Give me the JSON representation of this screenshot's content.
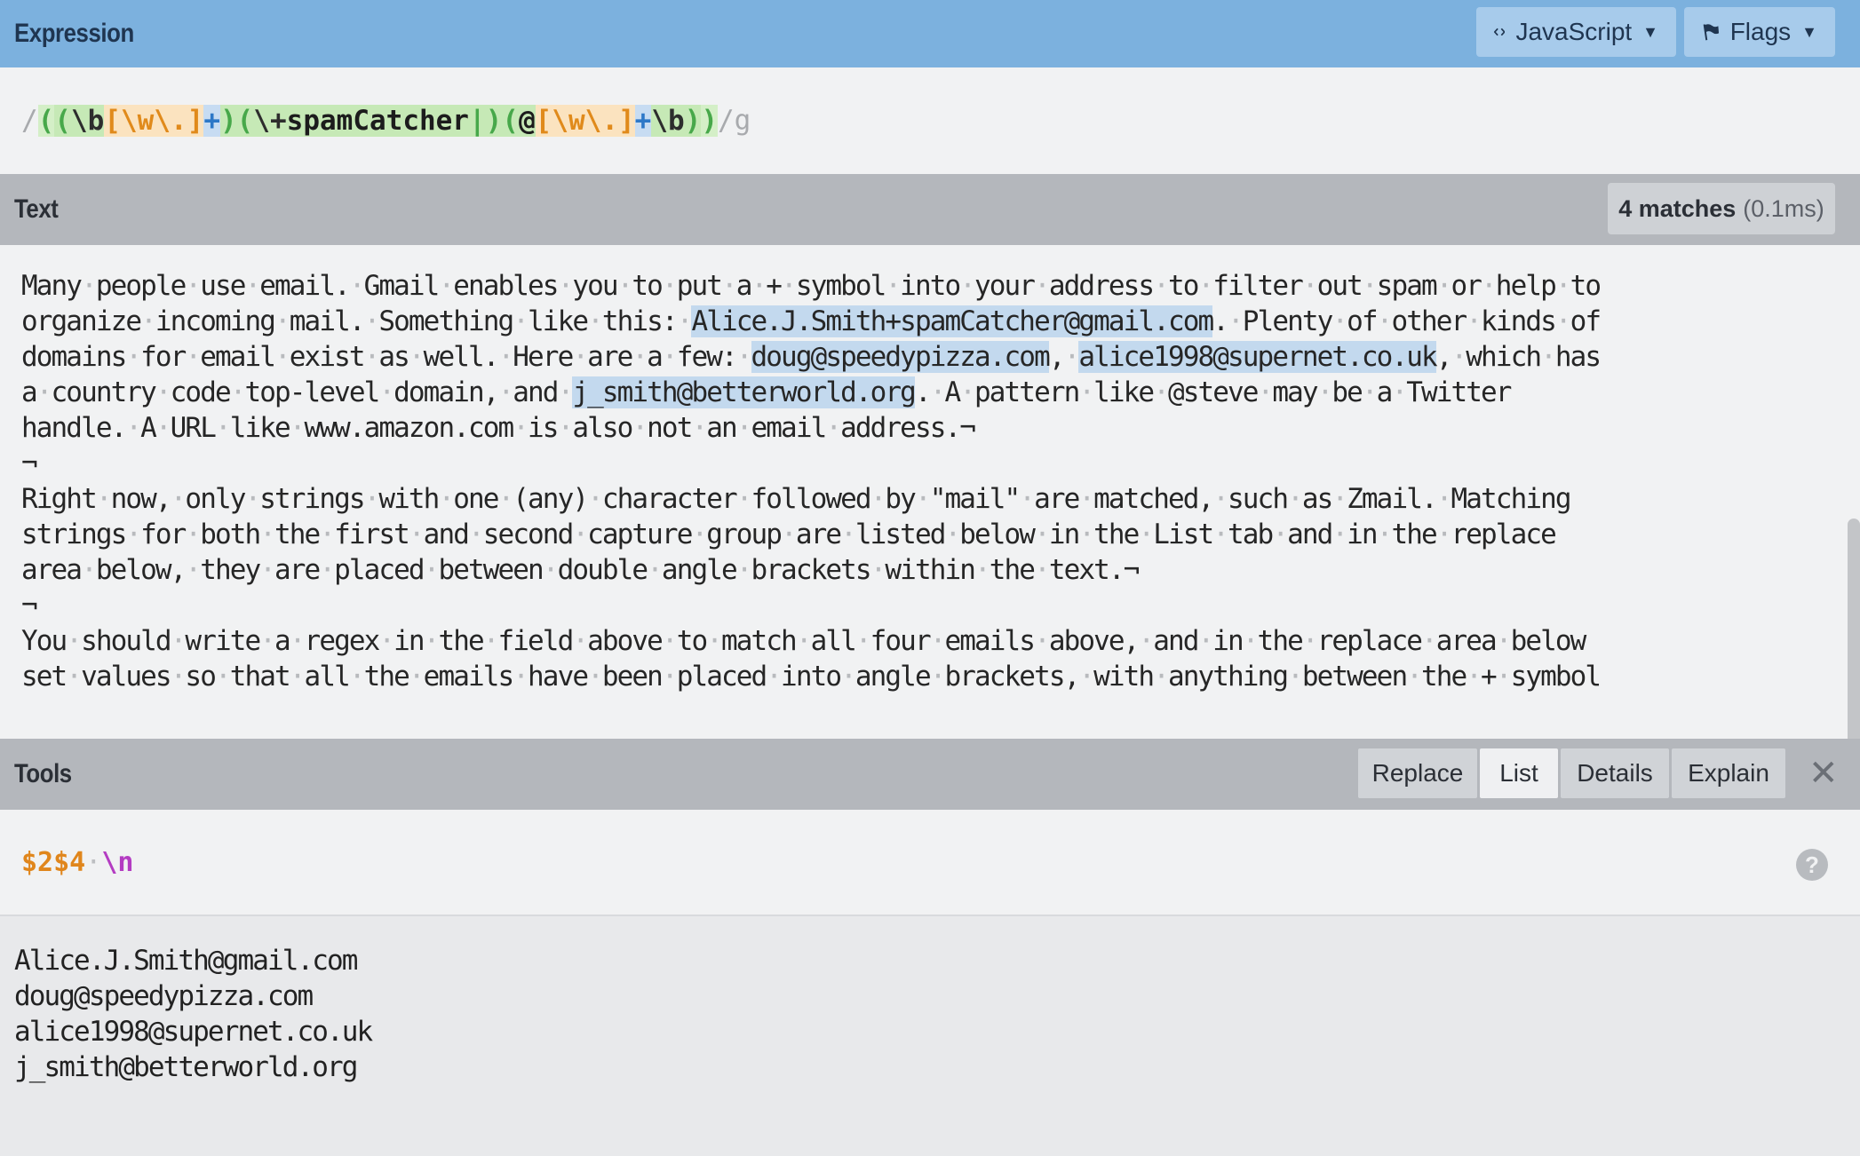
{
  "expression": {
    "title": "Expression",
    "language_label": "JavaScript",
    "flags_label": "Flags",
    "open_delim": "/",
    "tokens": {
      "g1_open": "(",
      "g2_open": "(",
      "b1": "\\b",
      "set1": "[\\w\\.]",
      "q1": "+",
      "g2_close": ")",
      "g3_open": "(",
      "esc_plus": "\\+",
      "literal": "spamCatcher",
      "alt": "|",
      "g3_close": ")",
      "g4_open": "(",
      "at": "@",
      "set2": "[\\w\\.]",
      "q2": "+",
      "b2": "\\b",
      "g4_close": ")",
      "g1_close": ")"
    },
    "close_delim": "/",
    "flags": "g"
  },
  "text_panel": {
    "title": "Text",
    "match_count": "4 matches",
    "match_time": "(0.1ms)",
    "lines": [
      "Many people use email. Gmail enables you to put a + symbol into your address to filter out spam or help to",
      "organize incoming mail. Something like this: |Alice.J.Smith+spamCatcher@gmail.com|. Plenty of other kinds of",
      "domains for email exist as well. Here are a few: |doug@speedypizza.com|, |alice1998@supernet.co.uk|, which has",
      "a country code top-level domain, and |j_smith@betterworld.org|. A pattern like @steve may be a Twitter",
      "handle. A URL like www.amazon.com is also not an email address.¬",
      "¬",
      "Right now, only strings with one (any) character followed by \"mail\" are matched, such as Zmail. Matching",
      "strings for both the first and second capture group are listed below in the List tab and in the replace",
      "area below, they are placed between double angle brackets within the text.¬",
      "¬",
      "You should write a regex in the field above to match all four emails above, and in the replace area below",
      "set values so that all the emails have been placed into angle brackets, with anything between the + symbol"
    ]
  },
  "tools": {
    "title": "Tools",
    "tabs": [
      "Replace",
      "List",
      "Details",
      "Explain"
    ],
    "active_tab": "List",
    "close_glyph": "✕",
    "replace_ref": "$2$4",
    "replace_newline": "\\n",
    "help_glyph": "?",
    "results": [
      "Alice.J.Smith@gmail.com",
      "doug@speedypizza.com",
      "alice1998@supernet.co.uk",
      "j_smith@betterworld.org"
    ]
  },
  "icons": {
    "language": "code-brackets-icon",
    "flags": "flag-icon",
    "close": "close-icon",
    "help": "help-icon"
  }
}
